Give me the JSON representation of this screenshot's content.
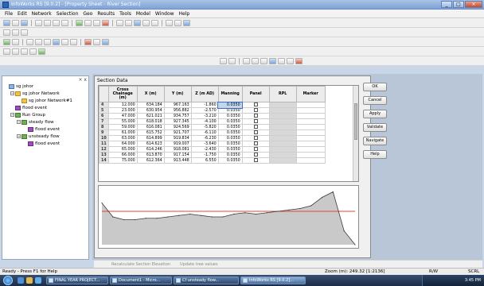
{
  "window": {
    "title": "InfoWorks RS [9.0.2] - [Property Sheet - River Section]",
    "controls": [
      "_",
      "□",
      "×"
    ]
  },
  "menu": [
    "File",
    "Edit",
    "Network",
    "Selection",
    "Geo",
    "Results",
    "Tools",
    "Model",
    "Window",
    "Help"
  ],
  "explorer": {
    "close_label": "× x",
    "items": [
      {
        "label": "sg johor",
        "icon": "database-icon",
        "level": 0,
        "toggle": ""
      },
      {
        "label": "sg johor Network",
        "icon": "network-icon",
        "level": 1,
        "toggle": "−"
      },
      {
        "label": "sg johor Network#1",
        "icon": "network-icon",
        "level": 2,
        "toggle": ""
      },
      {
        "label": "flood event",
        "icon": "event-icon",
        "level": 1,
        "toggle": ""
      },
      {
        "label": "Run Group",
        "icon": "run-group-icon",
        "level": 1,
        "toggle": "−"
      },
      {
        "label": "steady flow",
        "icon": "run-icon",
        "level": 2,
        "toggle": "−"
      },
      {
        "label": "flood event",
        "icon": "event-icon",
        "level": 3,
        "toggle": ""
      },
      {
        "label": "unsteady flow",
        "icon": "run-icon",
        "level": 2,
        "toggle": "−"
      },
      {
        "label": "flood event",
        "icon": "event-icon",
        "level": 3,
        "toggle": ""
      }
    ]
  },
  "section": {
    "title": "Section Data",
    "columns": [
      "Cross Chainage (m)",
      "X (m)",
      "Y (m)",
      "Z (m AD)",
      "Manning",
      "Panel",
      "RPL",
      "Marker"
    ],
    "rows": [
      {
        "n": "4",
        "chainage": "12.000",
        "x": "634.184",
        "y": "967.163",
        "z": "-1.860",
        "manning": "0.0350"
      },
      {
        "n": "5",
        "chainage": "23.000",
        "x": "630.954",
        "y": "956.882",
        "z": "-2.570",
        "manning": "0.0350"
      },
      {
        "n": "6",
        "chainage": "47.000",
        "x": "621.021",
        "y": "934.757",
        "z": "-3.210",
        "manning": "0.0350"
      },
      {
        "n": "7",
        "chainage": "55.000",
        "x": "618.018",
        "y": "927.345",
        "z": "-4.100",
        "manning": "0.0350"
      },
      {
        "n": "8",
        "chainage": "59.000",
        "x": "616.081",
        "y": "924.569",
        "z": "-5.820",
        "manning": "0.0350"
      },
      {
        "n": "9",
        "chainage": "61.000",
        "x": "615.752",
        "y": "921.707",
        "z": "-6.110",
        "manning": "0.0350"
      },
      {
        "n": "10",
        "chainage": "63.000",
        "x": "614.899",
        "y": "919.834",
        "z": "-6.230",
        "manning": "0.0350"
      },
      {
        "n": "11",
        "chainage": "64.000",
        "x": "614.623",
        "y": "919.007",
        "z": "-3.640",
        "manning": "0.0350"
      },
      {
        "n": "12",
        "chainage": "65.000",
        "x": "614.246",
        "y": "918.081",
        "z": "-2.430",
        "manning": "0.0350"
      },
      {
        "n": "13",
        "chainage": "66.000",
        "x": "613.870",
        "y": "917.154",
        "z": "-1.750",
        "manning": "0.0350"
      },
      {
        "n": "14",
        "chainage": "75.000",
        "x": "612.364",
        "y": "913.448",
        "z": "6.550",
        "manning": "0.0350"
      }
    ]
  },
  "buttons": [
    "OK",
    "Cancel",
    "Apply",
    "Validate",
    "Navigate",
    "Help"
  ],
  "bottom": {
    "left": "Recalculate Section Elevation",
    "mid": "Update tree values"
  },
  "status": {
    "ready": "Ready - Press F1 for Help",
    "zoom": "Zoom (m): 249.32 [1:2136]",
    "mode": "R/W",
    "scrl": "SCRL"
  },
  "taskbar": {
    "tasks": [
      "FINAL YEAR PROJECT...",
      "Document1 - Micro...",
      "Cf unsteady flow...",
      "InfoWorks RS [9.0.2]..."
    ],
    "clock": "3:45 PM"
  },
  "colors": {
    "water_level": "#e0463c",
    "bed": "#3a3a3a",
    "bed_fill": "#c9c9c9"
  },
  "chart_data": {
    "type": "area",
    "bed_profile": [
      [
        0,
        30
      ],
      [
        1,
        20
      ],
      [
        2,
        18
      ],
      [
        3,
        18
      ],
      [
        4,
        19
      ],
      [
        5,
        19
      ],
      [
        6,
        20
      ],
      [
        7,
        21
      ],
      [
        8,
        22
      ],
      [
        9,
        21
      ],
      [
        10,
        20
      ],
      [
        11,
        20
      ],
      [
        12,
        22
      ],
      [
        13,
        23
      ],
      [
        14,
        22
      ],
      [
        15,
        23
      ],
      [
        16,
        24
      ],
      [
        17,
        25
      ],
      [
        18,
        26
      ],
      [
        19,
        28
      ],
      [
        20,
        34
      ],
      [
        21,
        38
      ],
      [
        22,
        10
      ],
      [
        23,
        0
      ]
    ],
    "water_level": 24
  }
}
